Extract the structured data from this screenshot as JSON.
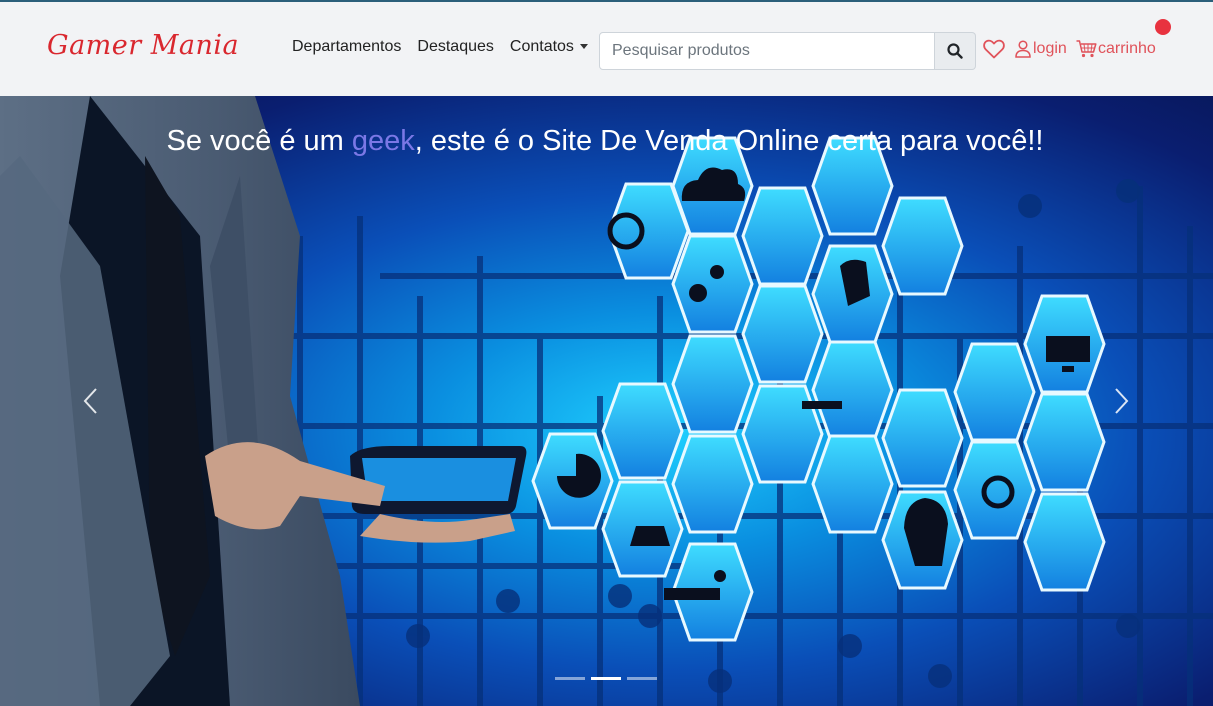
{
  "brand": {
    "name": "Gamer Mania"
  },
  "nav": {
    "departments": "Departamentos",
    "highlights": "Destaques",
    "contacts": "Contatos"
  },
  "search": {
    "placeholder": "Pesquisar produtos",
    "value": ""
  },
  "user": {
    "login_label": "login",
    "cart_label": "carrinho"
  },
  "colors": {
    "accent": "#e0525a",
    "brand": "#d9272e",
    "badge": "#e8323f",
    "title_accent": "#7b78e6"
  },
  "icons": [
    "search-icon",
    "heart-icon",
    "user-icon",
    "cart-icon",
    "chevron-left-icon",
    "chevron-right-icon"
  ],
  "hero": {
    "title_before": "Se você é um ",
    "title_accent": "geek",
    "title_after": ", este é o Site De Venda Online certa para você!!",
    "slide_count": 3,
    "active_slide": 2
  }
}
